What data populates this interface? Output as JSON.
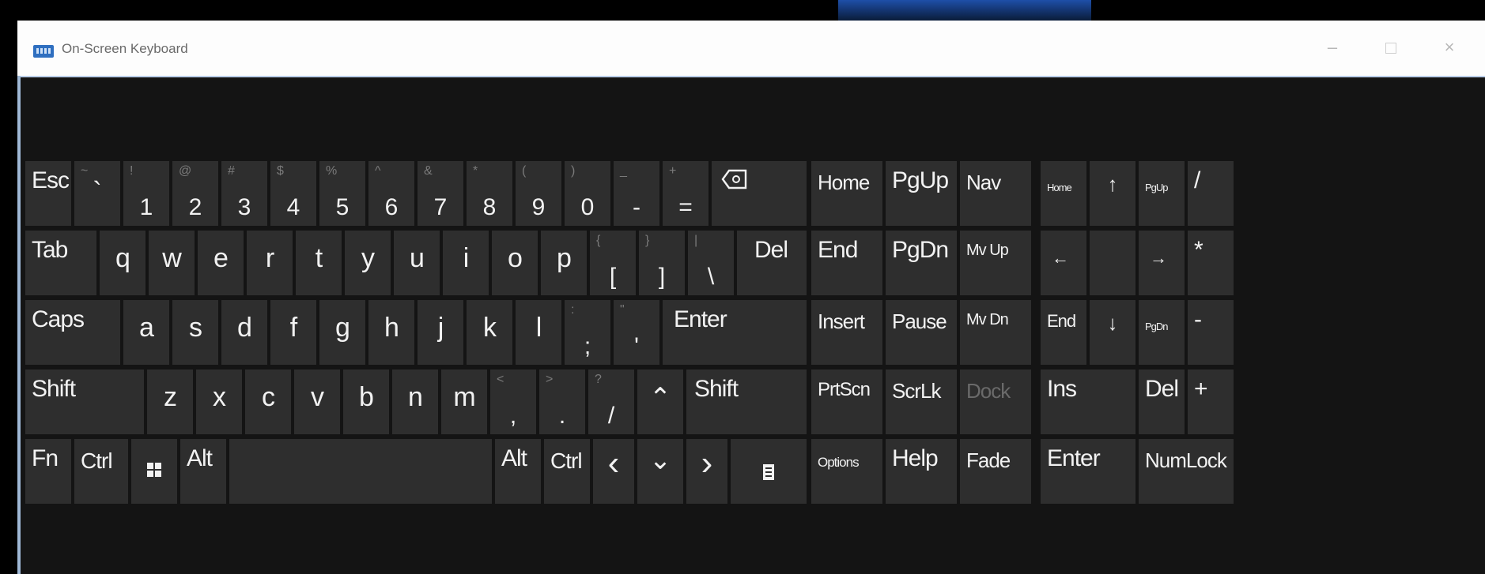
{
  "window": {
    "title": "On-Screen Keyboard",
    "minimize": "–",
    "close": "×"
  },
  "keys": {
    "esc": "Esc",
    "backtick": {
      "sub": "~",
      "main": "`"
    },
    "n1": {
      "sub": "!",
      "main": "1"
    },
    "n2": {
      "sub": "@",
      "main": "2"
    },
    "n3": {
      "sub": "#",
      "main": "3"
    },
    "n4": {
      "sub": "$",
      "main": "4"
    },
    "n5": {
      "sub": "%",
      "main": "5"
    },
    "n6": {
      "sub": "^",
      "main": "6"
    },
    "n7": {
      "sub": "&",
      "main": "7"
    },
    "n8": {
      "sub": "*",
      "main": "8"
    },
    "n9": {
      "sub": "(",
      "main": "9"
    },
    "n0": {
      "sub": ")",
      "main": "0"
    },
    "minus": {
      "sub": "_",
      "main": "-"
    },
    "equals": {
      "sub": "+",
      "main": "="
    },
    "tab": "Tab",
    "q": "q",
    "w": "w",
    "e": "e",
    "r": "r",
    "t": "t",
    "y": "y",
    "u": "u",
    "i": "i",
    "o": "o",
    "p": "p",
    "lbracket": {
      "sub": "{",
      "main": "["
    },
    "rbracket": {
      "sub": "}",
      "main": "]"
    },
    "backslash": {
      "sub": "|",
      "main": "\\"
    },
    "del": "Del",
    "caps": "Caps",
    "a": "a",
    "s": "s",
    "d": "d",
    "f": "f",
    "g": "g",
    "h": "h",
    "j": "j",
    "k": "k",
    "l": "l",
    "semicolon": {
      "sub": ":",
      "main": ";"
    },
    "quote": {
      "sub": "\"",
      "main": "'"
    },
    "enter": "Enter",
    "shift": "Shift",
    "z": "z",
    "x": "x",
    "c": "c",
    "v": "v",
    "b": "b",
    "n": "n",
    "m": "m",
    "comma": {
      "sub": "<",
      "main": ","
    },
    "period": {
      "sub": ">",
      "main": "."
    },
    "slash": {
      "sub": "?",
      "main": "/"
    },
    "fn": "Fn",
    "ctrl": "Ctrl",
    "alt": "Alt",
    "alt_r": "Alt",
    "ctrl_r": "Ctrl",
    "home": "Home",
    "pgup": "PgUp",
    "nav": "Nav",
    "end": "End",
    "pgdn": "PgDn",
    "mvup": "Mv Up",
    "insert": "Insert",
    "pause": "Pause",
    "mvdn": "Mv Dn",
    "prtscn": "PrtScn",
    "scrlk": "ScrLk",
    "dock": "Dock",
    "options": "Options",
    "help": "Help",
    "fade": "Fade",
    "np_home": "Home",
    "np_pgup": "PgUp",
    "np_slash": "/",
    "np_star": "*",
    "np_end": "End",
    "np_pgdn": "PgDn",
    "np_minus": "-",
    "np_ins": "Ins",
    "np_del": "Del",
    "np_plus": "+",
    "np_enter": "Enter",
    "numlock": "NumLock"
  }
}
